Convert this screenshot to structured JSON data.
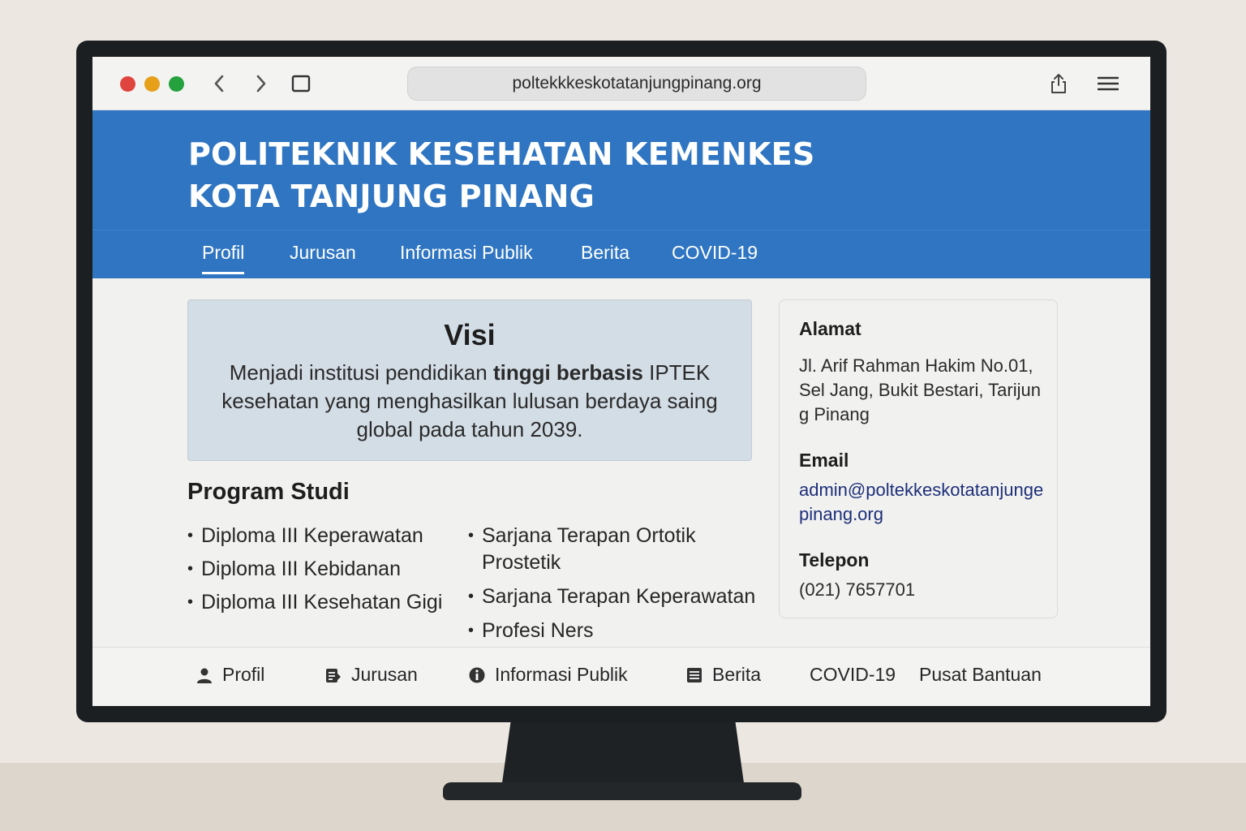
{
  "browser": {
    "url": "poltekkkeskotatanjungpinang.org"
  },
  "header": {
    "title_line1": "POLITEKNIK KESEHATAN KEMENKES",
    "title_line2": "KOTA TANJUNG PINANG"
  },
  "nav": {
    "items": [
      {
        "label": "Profil",
        "active": true
      },
      {
        "label": "Jurusan"
      },
      {
        "label": "Informasi Publik"
      },
      {
        "label": "Berita"
      },
      {
        "label": "COVID-19"
      }
    ]
  },
  "visi": {
    "title": "Visi",
    "text_before": "Menjadi institusi pendidikan ",
    "text_bold": "tinggi berbasis",
    "text_after": " IPTEK kesehatan yang menghasilkan lulusan berdaya saing global pada tahun 2039."
  },
  "program": {
    "title": "Program Studi",
    "col1": [
      "Diploma III Keperawatan",
      "Diploma III Kebidanan",
      "Diploma III Kesehatan Gigi"
    ],
    "col2": [
      "Sarjana Terapan Ortotik Prostetik",
      "Sarjana Terapan Keperawatan",
      "Profesi Ners"
    ]
  },
  "contact": {
    "address_label": "Alamat",
    "address_value": "Jl. Arif Rahman Hakim No.01, Sel Jang, Bukit Bestari, Tarijung Pinang",
    "email_label": "Email",
    "email_value": "admin@poltekkeskotatanjungepinang.org",
    "phone_label": "Telepon",
    "phone_value": "(021) 7657701"
  },
  "footer": {
    "items": [
      {
        "label": "Profil",
        "icon": "person-icon"
      },
      {
        "label": "Jurusan",
        "icon": "document-icon"
      },
      {
        "label": "Informasi Publik",
        "icon": "info-icon"
      },
      {
        "label": "Berita",
        "icon": "newspaper-icon"
      },
      {
        "label": "COVID-19"
      },
      {
        "label": "Pusat Bantuan"
      }
    ]
  },
  "colors": {
    "header_blue": "#2f75c2",
    "visi_bg": "#d3dde6",
    "email_link": "#1d2f7a"
  }
}
